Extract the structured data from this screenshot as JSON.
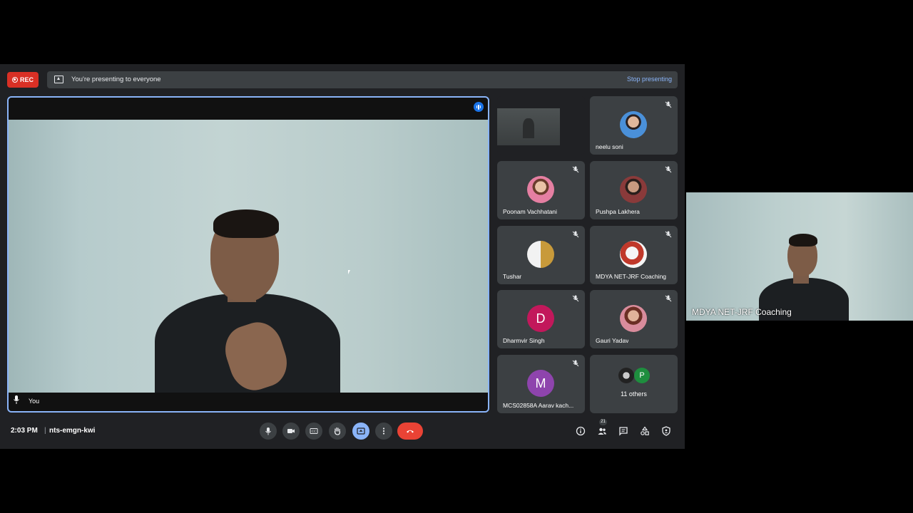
{
  "top_bar": {
    "rec_label": "REC",
    "presenting_text": "You're presenting to everyone",
    "stop_presenting_label": "Stop presenting"
  },
  "main_tile": {
    "label": "You"
  },
  "participants": [
    {
      "name": "neelu soni",
      "avatar_type": "photo",
      "muted": true
    },
    {
      "name": "Poonam Vachhatani",
      "avatar_type": "photo",
      "muted": true
    },
    {
      "name": "Pushpa Lakhera",
      "avatar_type": "photo",
      "muted": true
    },
    {
      "name": "Tushar",
      "avatar_type": "photo",
      "muted": true
    },
    {
      "name": "MDYA NET-JRF Coaching",
      "avatar_type": "photo",
      "muted": true
    },
    {
      "name": "Dharmvir Singh",
      "avatar_type": "letter",
      "letter": "D",
      "color": "#c2185b",
      "muted": true
    },
    {
      "name": "Gauri Yadav",
      "avatar_type": "photo",
      "muted": true
    },
    {
      "name": "MCS02858A Aarav kach...",
      "avatar_type": "letter",
      "letter": "M",
      "color": "#8e44ad",
      "muted": true
    }
  ],
  "others": {
    "mini_letter": "P",
    "label": "11 others"
  },
  "bottom_bar": {
    "time": "2:03 PM",
    "separator": "|",
    "meeting_code": "nts-emgn-kwi",
    "people_count": "21",
    "controls": [
      "mic-icon",
      "camera-icon",
      "captions-icon",
      "raise-hand-icon",
      "present-icon",
      "more-icon",
      "end-call-icon"
    ],
    "right_icons": [
      "info-icon",
      "people-icon",
      "chat-icon",
      "activities-icon",
      "host-controls-icon"
    ]
  },
  "side_view": {
    "label": "MDYA NET-JRF Coaching"
  },
  "colors": {
    "meet_bg": "#202124",
    "tile_bg": "#3c4043",
    "accent_blue": "#8ab4f8",
    "rec_red": "#d93025",
    "end_call_red": "#ea4335"
  }
}
